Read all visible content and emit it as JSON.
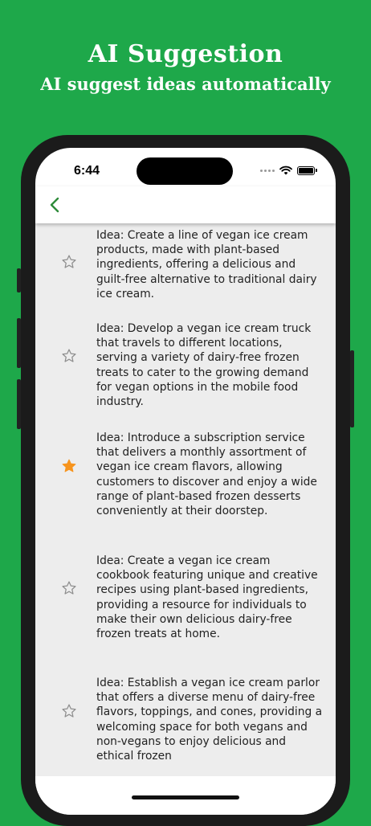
{
  "promo": {
    "title": "AI Suggestion",
    "subtitle": "AI suggest ideas automatically"
  },
  "status_bar": {
    "time": "6:44",
    "icons": [
      "cellular-dots-icon",
      "wifi-icon",
      "battery-icon"
    ]
  },
  "nav": {
    "back_icon": "chevron-left-icon",
    "accent_color": "#2e8b3a"
  },
  "colors": {
    "background": "#1ea84a",
    "star_filled": "#f7941d",
    "star_outline": "#8e8e8e",
    "list_background": "#ededed"
  },
  "ideas": [
    {
      "text": "Idea: Create a line of vegan ice cream products, made with plant-based ingredients, offering a delicious and guilt-free alternative to traditional dairy ice cream.",
      "starred": false
    },
    {
      "text": "Idea: Develop a vegan ice cream truck that travels to different locations, serving a variety of dairy-free frozen treats to cater to the growing demand for vegan options in the mobile food industry.",
      "starred": false
    },
    {
      "text": "Idea: Introduce a subscription service that delivers a monthly assortment of vegan ice cream flavors, allowing customers to discover and enjoy a wide range of plant-based frozen desserts conveniently at their doorstep.",
      "starred": true
    },
    {
      "text": "Idea: Create a vegan ice cream cookbook featuring unique and creative recipes using plant-based ingredients, providing a resource for individuals to make their own delicious dairy-free frozen treats at home.",
      "starred": false
    },
    {
      "text": "Idea: Establish a vegan ice cream parlor that offers a diverse menu of dairy-free flavors, toppings, and cones, providing a welcoming space for both vegans and non-vegans to enjoy delicious and ethical frozen",
      "starred": false
    }
  ]
}
